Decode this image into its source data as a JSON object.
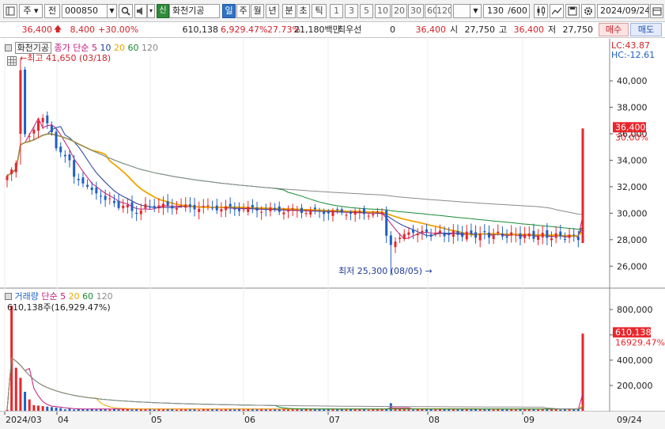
{
  "toolbar": {
    "market_label": "주",
    "prev_label": "전",
    "code": "000850",
    "badge": "신",
    "stock_name": "화천기공",
    "period_day": "일",
    "period_week": "주",
    "period_month": "월",
    "period_year": "년",
    "period_minute": "분",
    "period_second": "초",
    "period_tick": "틱",
    "intervals": [
      "1",
      "3",
      "5",
      "10",
      "20",
      "30",
      "60",
      "120"
    ],
    "count": "130",
    "count_max": "/600",
    "date": "2024/09/24"
  },
  "quote": {
    "price": "36,400",
    "change": "8,400",
    "change_pct": "+30.00%",
    "volume": "610,138",
    "volume_ratio": "6,929.47%",
    "turnover": "27.73%",
    "amount": "21,180백만",
    "priority_label": "최우선",
    "priority_value": "0",
    "best_price": "36,400",
    "open_label": "시",
    "open": "27,750",
    "high_label": "고",
    "high": "36,400",
    "low_label": "저",
    "low": "27,750",
    "buy_label": "매수",
    "sell_label": "매도"
  },
  "price_panel": {
    "title": "화천기공",
    "ma_label": "종가 단순",
    "ma_periods": [
      "5",
      "10",
      "20",
      "60",
      "120"
    ],
    "ma_colors": [
      "#c2187a",
      "#1f3a99",
      "#f0a500",
      "#188a35",
      "#8a8a8a"
    ],
    "lc": "LC:43.87",
    "hc": "HC:-12.61",
    "high_annotation": "최고 41,650 (03/18)",
    "low_annotation": "최저 25,300 (08/05)",
    "current_price": "36,400",
    "current_pct": "30.00%",
    "y_ticks": [
      "40,000",
      "38,000",
      "36,000",
      "34,000",
      "32,000",
      "30,000",
      "28,000",
      "26,000"
    ]
  },
  "volume_panel": {
    "title": "거래량",
    "ma_label": "단순",
    "ma_periods": [
      "5",
      "20",
      "60",
      "120"
    ],
    "summary": "610,138주(16,929.47%)",
    "current_volume": "610,138",
    "current_pct": "16929.47%",
    "y_ticks": [
      "800,000",
      "600,000",
      "400,000",
      "200,000"
    ]
  },
  "x_axis": {
    "labels": [
      "2024/03",
      "04",
      "05",
      "06",
      "07",
      "08",
      "09"
    ],
    "current": "09/24"
  },
  "colors": {
    "up": "#e8262b",
    "down": "#1f5fc4",
    "accent": "#2f72c4"
  },
  "chart_data": {
    "type": "candlestick",
    "price_ylim": [
      25000,
      41500
    ],
    "volume_ylim": [
      0,
      900000
    ],
    "months": [
      "2024/03",
      "04",
      "05",
      "06",
      "07",
      "08",
      "09"
    ],
    "key_points": [
      {
        "date": "03/18",
        "high": 41650
      },
      {
        "date": "08/05",
        "low": 25300
      },
      {
        "date": "09/24",
        "open": 27750,
        "high": 36400,
        "low": 27750,
        "close": 36400,
        "volume": 610138
      }
    ]
  }
}
